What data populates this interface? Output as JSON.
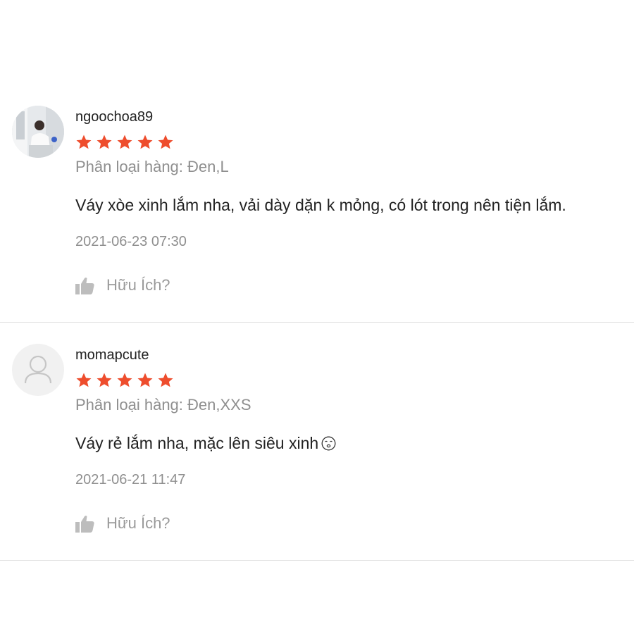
{
  "reviews": [
    {
      "username": "ngoochoa89",
      "rating": 5,
      "variation": "Phân loại hàng: Đen,L",
      "comment": "Váy xòe xinh lắm nha, vải dày dặn k mỏng, có lót trong nên tiện lắm.",
      "date": "2021-06-23 07:30",
      "helpful_label": "Hữu Ích?",
      "avatar": "user-photo"
    },
    {
      "username": "momapcute",
      "rating": 5,
      "variation": "Phân loại hàng: Đen,XXS",
      "comment": "Váy rẻ lắm nha, mặc lên siêu xinh",
      "comment_emoji": "smiling-face-emoji",
      "date": "2021-06-21 11:47",
      "helpful_label": "Hữu Ích?",
      "avatar": "default-user-icon"
    }
  ],
  "colors": {
    "star": "#ee4d2d",
    "muted_text": "#8f8f8f",
    "divider": "#e2e2e2"
  },
  "icons": {
    "star": "star-icon",
    "helpful": "thumbs-up-icon"
  }
}
